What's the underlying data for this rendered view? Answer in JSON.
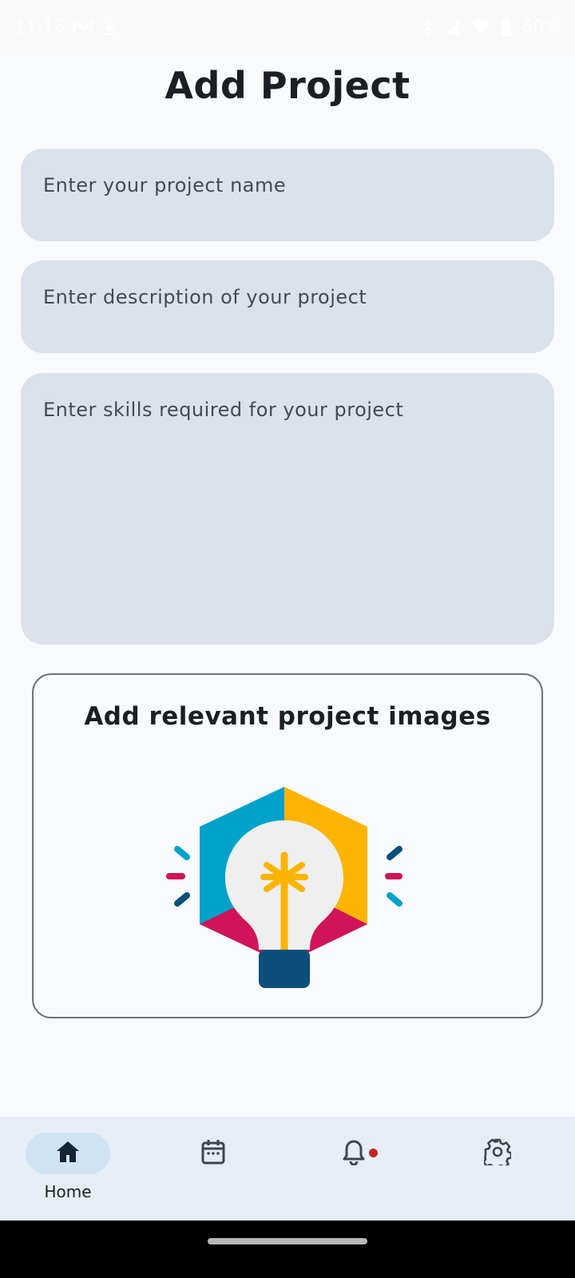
{
  "status_bar": {
    "time": "11:16",
    "battery": "60%"
  },
  "page": {
    "title": "Add Project"
  },
  "form": {
    "project_name_placeholder": "Enter your project name",
    "description_placeholder": "Enter description of your project",
    "skills_placeholder": "Enter skills required for your project"
  },
  "image_card": {
    "title": "Add relevant project images"
  },
  "bottom_nav": {
    "items": [
      {
        "label": "Home",
        "icon": "home-icon",
        "active": true
      },
      {
        "label": "",
        "icon": "calendar-icon",
        "active": false
      },
      {
        "label": "",
        "icon": "bell-icon",
        "active": false,
        "badge": true
      },
      {
        "label": "",
        "icon": "gear-icon",
        "active": false
      }
    ]
  },
  "colors": {
    "background": "#f8fafd",
    "field": "#dce2e9",
    "nav_background": "#e7edf4",
    "nav_active_pill": "#cfe3f4",
    "badge": "#c0261f",
    "bulb_blue": "#00a2c9",
    "bulb_yellow": "#fbb400",
    "bulb_magenta": "#d0145a",
    "bulb_navy": "#0b4f7a"
  }
}
